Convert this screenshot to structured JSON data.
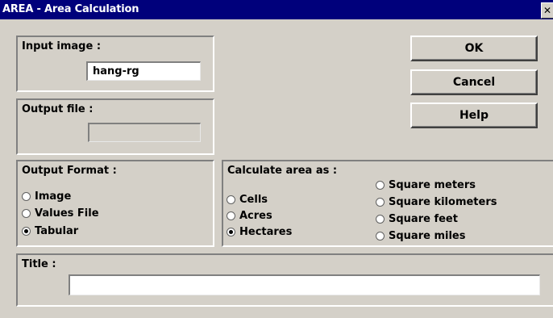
{
  "window": {
    "title": "AREA - Area Calculation"
  },
  "input_image": {
    "label": "Input image :",
    "value": "hang-rg"
  },
  "output_file": {
    "label": "Output file :",
    "value": ""
  },
  "buttons": {
    "ok": "OK",
    "cancel": "Cancel",
    "help": "Help"
  },
  "output_format": {
    "label": "Output Format :",
    "options": [
      "Image",
      "Values File",
      "Tabular"
    ],
    "selected": "Tabular"
  },
  "calculate_area": {
    "label": "Calculate area as :",
    "options_left": [
      "Cells",
      "Acres",
      "Hectares"
    ],
    "options_right": [
      "Square meters",
      "Square kilometers",
      "Square feet",
      "Square miles"
    ],
    "selected": "Hectares"
  },
  "title_field": {
    "label": "Title :",
    "value": ""
  }
}
